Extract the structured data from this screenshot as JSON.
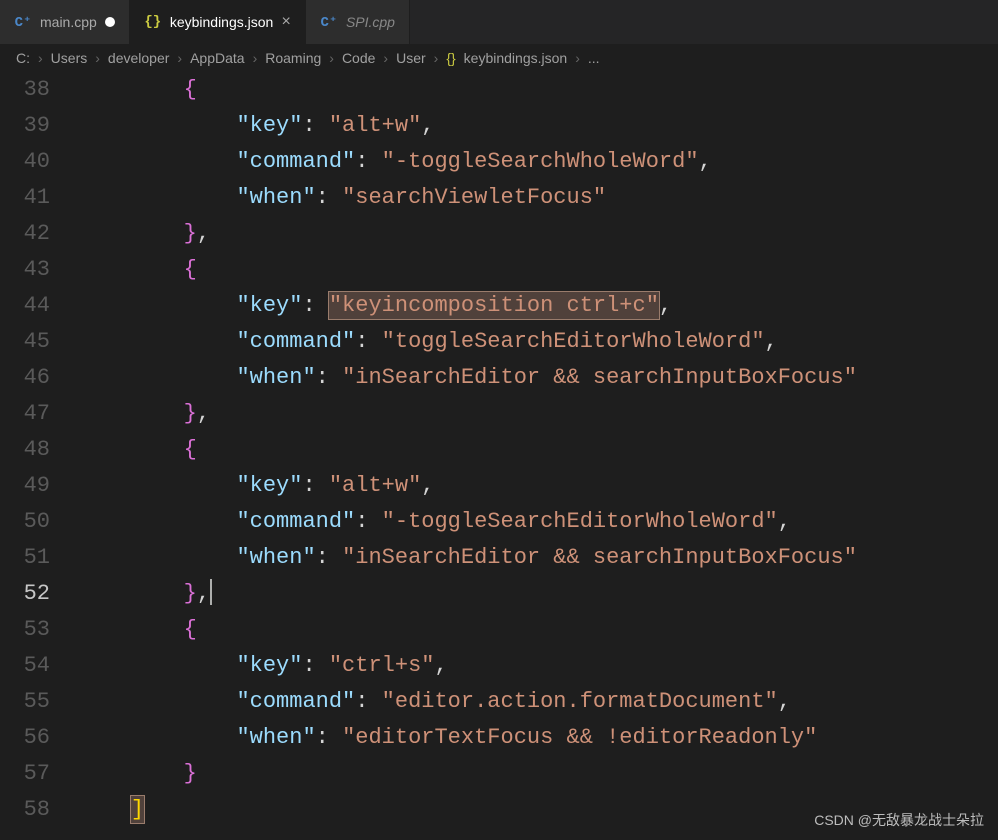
{
  "tabs": [
    {
      "label": "main.cpp",
      "iconType": "cpp",
      "iconText": "C⁺",
      "dirty": true,
      "active": false,
      "italic": false
    },
    {
      "label": "keybindings.json",
      "iconType": "json",
      "iconText": "{}",
      "dirty": false,
      "active": true,
      "italic": false
    },
    {
      "label": "SPI.cpp",
      "iconType": "cpp",
      "iconText": "C⁺",
      "dirty": false,
      "active": false,
      "italic": true
    }
  ],
  "breadcrumbs": {
    "items": [
      "C:",
      "Users",
      "developer",
      "AppData",
      "Roaming",
      "Code",
      "User"
    ],
    "fileIcon": "{}",
    "fileName": "keybindings.json",
    "trailing": "..."
  },
  "lines": {
    "start": 38,
    "active": 52,
    "rows": [
      {
        "n": 38,
        "indent": "        ",
        "tokens": [
          {
            "t": "brace",
            "v": "{"
          }
        ]
      },
      {
        "n": 39,
        "indent": "            ",
        "tokens": [
          {
            "t": "key",
            "v": "\"key\""
          },
          {
            "t": "punc",
            "v": ": "
          },
          {
            "t": "str",
            "v": "\"alt+w\""
          },
          {
            "t": "punc",
            "v": ","
          }
        ]
      },
      {
        "n": 40,
        "indent": "            ",
        "tokens": [
          {
            "t": "key",
            "v": "\"command\""
          },
          {
            "t": "punc",
            "v": ": "
          },
          {
            "t": "str",
            "v": "\"-toggleSearchWholeWord\""
          },
          {
            "t": "punc",
            "v": ","
          }
        ]
      },
      {
        "n": 41,
        "indent": "            ",
        "tokens": [
          {
            "t": "key",
            "v": "\"when\""
          },
          {
            "t": "punc",
            "v": ": "
          },
          {
            "t": "str",
            "v": "\"searchViewletFocus\""
          }
        ]
      },
      {
        "n": 42,
        "indent": "        ",
        "tokens": [
          {
            "t": "brace",
            "v": "}"
          },
          {
            "t": "punc",
            "v": ","
          }
        ]
      },
      {
        "n": 43,
        "indent": "        ",
        "tokens": [
          {
            "t": "brace",
            "v": "{"
          }
        ]
      },
      {
        "n": 44,
        "indent": "            ",
        "tokens": [
          {
            "t": "key",
            "v": "\"key\""
          },
          {
            "t": "punc",
            "v": ": "
          },
          {
            "t": "str",
            "v": "\"keyincomposition ctrl+c\"",
            "hl": true
          },
          {
            "t": "punc",
            "v": ","
          }
        ]
      },
      {
        "n": 45,
        "indent": "            ",
        "tokens": [
          {
            "t": "key",
            "v": "\"command\""
          },
          {
            "t": "punc",
            "v": ": "
          },
          {
            "t": "str",
            "v": "\"toggleSearchEditorWholeWord\""
          },
          {
            "t": "punc",
            "v": ","
          }
        ]
      },
      {
        "n": 46,
        "indent": "            ",
        "tokens": [
          {
            "t": "key",
            "v": "\"when\""
          },
          {
            "t": "punc",
            "v": ": "
          },
          {
            "t": "str",
            "v": "\"inSearchEditor && searchInputBoxFocus\""
          }
        ]
      },
      {
        "n": 47,
        "indent": "        ",
        "tokens": [
          {
            "t": "brace",
            "v": "}"
          },
          {
            "t": "punc",
            "v": ","
          }
        ]
      },
      {
        "n": 48,
        "indent": "        ",
        "tokens": [
          {
            "t": "brace",
            "v": "{"
          }
        ]
      },
      {
        "n": 49,
        "indent": "            ",
        "tokens": [
          {
            "t": "key",
            "v": "\"key\""
          },
          {
            "t": "punc",
            "v": ": "
          },
          {
            "t": "str",
            "v": "\"alt+w\""
          },
          {
            "t": "punc",
            "v": ","
          }
        ]
      },
      {
        "n": 50,
        "indent": "            ",
        "tokens": [
          {
            "t": "key",
            "v": "\"command\""
          },
          {
            "t": "punc",
            "v": ": "
          },
          {
            "t": "str",
            "v": "\"-toggleSearchEditorWholeWord\""
          },
          {
            "t": "punc",
            "v": ","
          }
        ]
      },
      {
        "n": 51,
        "indent": "            ",
        "tokens": [
          {
            "t": "key",
            "v": "\"when\""
          },
          {
            "t": "punc",
            "v": ": "
          },
          {
            "t": "str",
            "v": "\"inSearchEditor && searchInputBoxFocus\""
          }
        ]
      },
      {
        "n": 52,
        "indent": "        ",
        "tokens": [
          {
            "t": "brace",
            "v": "}"
          },
          {
            "t": "punc",
            "v": ","
          },
          {
            "t": "cursor",
            "v": ""
          }
        ]
      },
      {
        "n": 53,
        "indent": "        ",
        "tokens": [
          {
            "t": "brace",
            "v": "{"
          }
        ]
      },
      {
        "n": 54,
        "indent": "            ",
        "tokens": [
          {
            "t": "key",
            "v": "\"key\""
          },
          {
            "t": "punc",
            "v": ": "
          },
          {
            "t": "str",
            "v": "\"ctrl+s\""
          },
          {
            "t": "punc",
            "v": ","
          }
        ]
      },
      {
        "n": 55,
        "indent": "            ",
        "tokens": [
          {
            "t": "key",
            "v": "\"command\""
          },
          {
            "t": "punc",
            "v": ": "
          },
          {
            "t": "str",
            "v": "\"editor.action.formatDocument\""
          },
          {
            "t": "punc",
            "v": ","
          }
        ]
      },
      {
        "n": 56,
        "indent": "            ",
        "tokens": [
          {
            "t": "key",
            "v": "\"when\""
          },
          {
            "t": "punc",
            "v": ": "
          },
          {
            "t": "str",
            "v": "\"editorTextFocus && !editorReadonly\""
          }
        ]
      },
      {
        "n": 57,
        "indent": "        ",
        "tokens": [
          {
            "t": "brace",
            "v": "}"
          }
        ]
      },
      {
        "n": 58,
        "indent": "    ",
        "tokens": [
          {
            "t": "bracket",
            "v": "]",
            "hl": true
          }
        ]
      }
    ]
  },
  "watermark": "CSDN @无敌暴龙战士朵拉"
}
